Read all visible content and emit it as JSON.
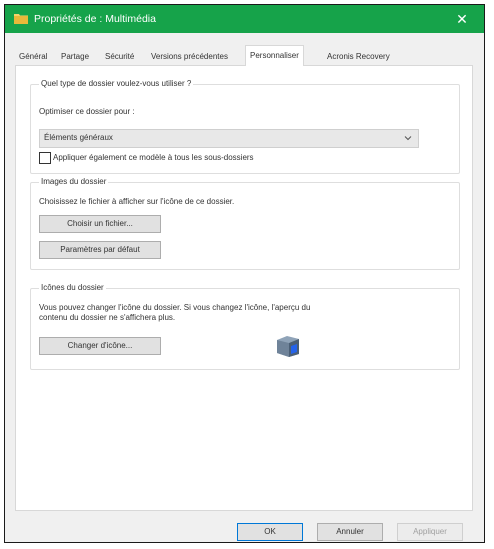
{
  "window": {
    "title": "Propriétés de : Multimédia",
    "close_label": "✕"
  },
  "tabs": [
    {
      "label": "Général"
    },
    {
      "label": "Partage"
    },
    {
      "label": "Sécurité"
    },
    {
      "label": "Versions précédentes"
    },
    {
      "label": "Personnaliser"
    },
    {
      "label": "Acronis Recovery"
    }
  ],
  "active_tab": "Personnaliser",
  "folder_type": {
    "title": "Quel type de dossier voulez-vous utiliser ?",
    "optimize_label": "Optimiser ce dossier pour :",
    "selected_value": "Éléments généraux",
    "apply_subfolders_label": "Appliquer également ce modèle à tous les sous-dossiers",
    "apply_subfolders_checked": false
  },
  "folder_pictures": {
    "title": "Images du dossier",
    "description": "Choisissez le fichier à afficher sur l'icône de ce dossier.",
    "choose_file_button": "Choisir un fichier...",
    "restore_default_button": "Paramètres par défaut"
  },
  "folder_icons": {
    "title": "Icônes du dossier",
    "description_line1": "Vous pouvez changer l'icône du dossier. Si vous changez l'icône, l'aperçu du",
    "description_line2": "contenu du dossier ne s'affichera plus.",
    "change_icon_button": "Changer d'icône...",
    "preview_icon": "folder-icon"
  },
  "footer": {
    "ok": "OK",
    "cancel": "Annuler",
    "apply": "Appliquer",
    "apply_enabled": false
  },
  "colors": {
    "titlebar": "#16a34a",
    "ok_border": "#0078d7"
  }
}
